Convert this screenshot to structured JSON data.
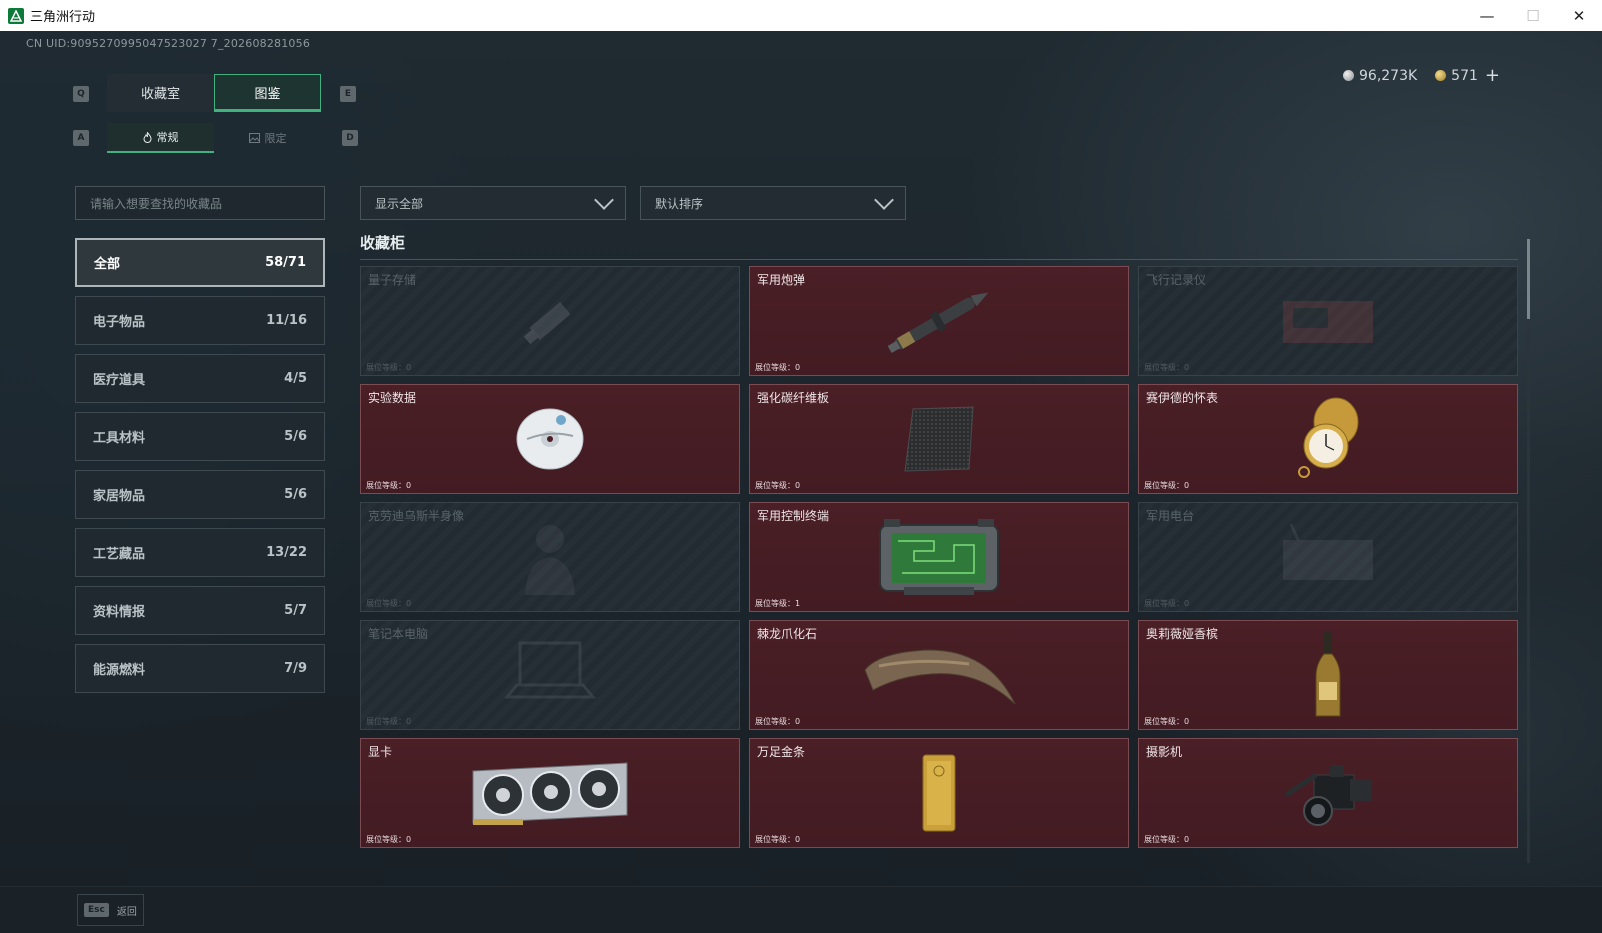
{
  "window": {
    "title": "三角洲行动",
    "min_glyph": "—",
    "max_glyph": "☐",
    "close_glyph": "✕"
  },
  "uid": "CN UID:9095270995047523027 7_202608281056",
  "currency": {
    "silver": "96,273K",
    "gold": "571",
    "plus": "+"
  },
  "keys": {
    "q": "Q",
    "e": "E",
    "a": "A",
    "d": "D"
  },
  "tabs": [
    {
      "label": "收藏室",
      "active": false
    },
    {
      "label": "图鉴",
      "active": true
    }
  ],
  "subtabs": [
    {
      "label": "常规",
      "icon": "flame-icon",
      "active": true
    },
    {
      "label": "限定",
      "icon": "image-icon",
      "active": false
    }
  ],
  "search": {
    "placeholder": "请输入想要查找的收藏品"
  },
  "filter": {
    "selected": "显示全部"
  },
  "sort": {
    "selected": "默认排序"
  },
  "categories": [
    {
      "label": "全部",
      "count": "58/71"
    },
    {
      "label": "电子物品",
      "count": "11/16"
    },
    {
      "label": "医疗道具",
      "count": "4/5"
    },
    {
      "label": "工具材料",
      "count": "5/6"
    },
    {
      "label": "家居物品",
      "count": "5/6"
    },
    {
      "label": "工艺藏品",
      "count": "13/22"
    },
    {
      "label": "资料情报",
      "count": "5/7"
    },
    {
      "label": "能源燃料",
      "count": "7/9"
    }
  ],
  "section_title": "收藏柜",
  "level_prefix": "展位等级：",
  "items": [
    {
      "name": "量子存储",
      "level": "0",
      "owned": false,
      "icon": "usb-drive-icon"
    },
    {
      "name": "军用炮弹",
      "level": "0",
      "owned": true,
      "icon": "artillery-shell-icon"
    },
    {
      "name": "飞行记录仪",
      "level": "0",
      "owned": false,
      "icon": "flight-recorder-icon"
    },
    {
      "name": "实验数据",
      "level": "0",
      "owned": true,
      "icon": "disc-icon"
    },
    {
      "name": "强化碳纤维板",
      "level": "0",
      "owned": true,
      "icon": "carbon-plate-icon"
    },
    {
      "name": "赛伊德的怀表",
      "level": "0",
      "owned": true,
      "icon": "pocket-watch-icon"
    },
    {
      "name": "克劳迪乌斯半身像",
      "level": "0",
      "owned": false,
      "icon": "bust-icon"
    },
    {
      "name": "军用控制终端",
      "level": "1",
      "owned": true,
      "icon": "control-terminal-icon"
    },
    {
      "name": "军用电台",
      "level": "0",
      "owned": false,
      "icon": "radio-icon"
    },
    {
      "name": "笔记本电脑",
      "level": "0",
      "owned": false,
      "icon": "laptop-icon"
    },
    {
      "name": "棘龙爪化石",
      "level": "0",
      "owned": true,
      "icon": "claw-fossil-icon"
    },
    {
      "name": "奥莉薇娅香槟",
      "level": "0",
      "owned": true,
      "icon": "champagne-icon"
    },
    {
      "name": "显卡",
      "level": "0",
      "owned": true,
      "icon": "graphics-card-icon"
    },
    {
      "name": "万足金条",
      "level": "0",
      "owned": true,
      "icon": "gold-bar-icon"
    },
    {
      "name": "摄影机",
      "level": "0",
      "owned": true,
      "icon": "camera-icon"
    }
  ],
  "back": {
    "key": "Esc",
    "label": "返回"
  }
}
